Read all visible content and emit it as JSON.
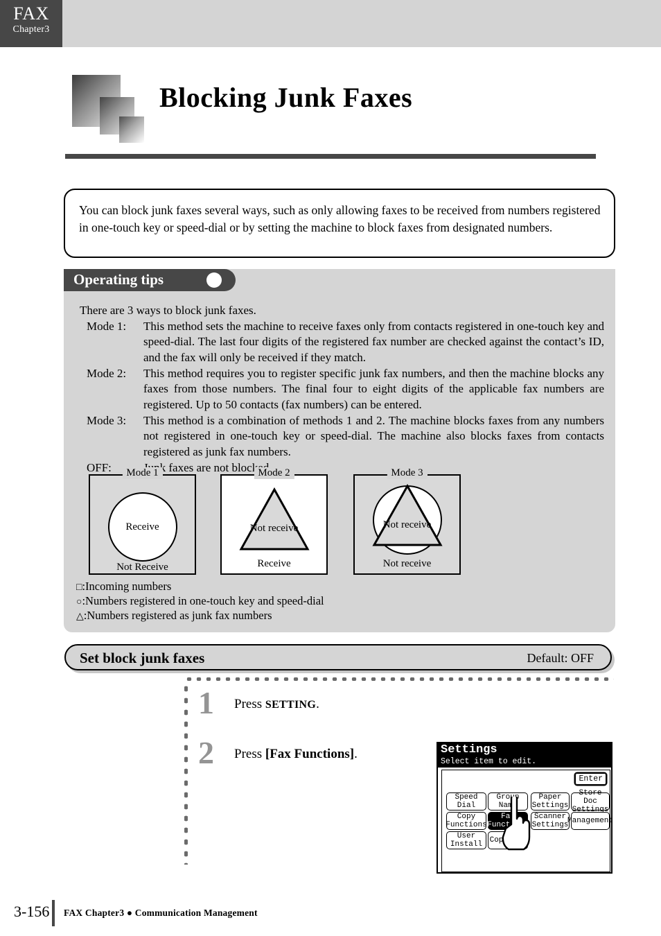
{
  "header": {
    "chapter_main": "FAX",
    "chapter_sub": "Chapter3"
  },
  "page_title": "Blocking Junk Faxes",
  "intro": "You can block junk faxes several ways, such as only allowing faxes to be received from numbers registered in one-touch key  or speed-dial or by setting the machine to block faxes from designated numbers.",
  "tips": {
    "header_label": "Operating tips",
    "header_icon": "circle-icon",
    "intro": "There are 3 ways to block junk faxes.",
    "modes": [
      {
        "label": "Mode 1:",
        "body": "This method sets the machine to receive faxes only from contacts registered in one-touch key and speed-dial. The last four digits of the registered fax number are checked against the contact’s ID, and the fax will only be received if they match."
      },
      {
        "label": "Mode 2:",
        "body": "This method requires you to register specific junk fax numbers, and then the machine blocks any faxes from those numbers. The final four to eight digits of the applicable fax numbers are registered. Up to 50 contacts (fax numbers) can be entered."
      },
      {
        "label": "Mode 3:",
        "body": "This method is a combination of methods 1 and 2. The machine blocks faxes from any numbers not registered in one-touch key or speed-dial. The machine also blocks faxes from contacts registered as junk fax numbers."
      },
      {
        "label": "OFF:",
        "body": "Junk faxes are not blocked."
      }
    ],
    "diagrams": [
      {
        "title": "Mode 1",
        "box_fill": "grey",
        "inner_text": "Receive",
        "outer_text": "Not Receive",
        "shapes": "circle"
      },
      {
        "title": "Mode 2",
        "box_fill": "white",
        "inner_text": "Not\nreceive",
        "outer_text": "Receive",
        "shapes": "triangle"
      },
      {
        "title": "Mode 3",
        "box_fill": "grey",
        "inner_text": "Not\nreceive",
        "outer_text": "Not receive",
        "shapes": "circle-triangle"
      }
    ],
    "legend": [
      {
        "glyph": "□",
        "text": ":Incoming numbers"
      },
      {
        "glyph": "○",
        "text": ":Numbers registered in one-touch key and speed-dial"
      },
      {
        "glyph": "△",
        "text": ":Numbers registered as junk fax numbers"
      }
    ]
  },
  "setting_bar": {
    "title": "Set block junk faxes",
    "default": "Default: OFF"
  },
  "steps": [
    {
      "number": "1",
      "prefix": "Press ",
      "key": "SETTING",
      "suffix": ".",
      "key_style": "smallcaps"
    },
    {
      "number": "2",
      "prefix": "Press ",
      "key": "[Fax Functions]",
      "suffix": ".",
      "key_style": "bold"
    }
  ],
  "lcd": {
    "title": "Settings",
    "subtitle": "Select item to edit.",
    "enter_label": "Enter",
    "buttons": [
      {
        "label": "Speed Dial",
        "selected": false
      },
      {
        "label": "Group Name",
        "selected": false
      },
      {
        "label": "Paper\nSettings",
        "selected": false
      },
      {
        "label": "Store Doc\nSettings",
        "selected": false
      },
      {
        "label": "Copy\nFunctions",
        "selected": false
      },
      {
        "label": "Fax\nFunctions",
        "selected": true
      },
      {
        "label": "Scanner\nSettings",
        "selected": false
      },
      {
        "label": "Management",
        "selected": false
      },
      {
        "label": "User\nInstall",
        "selected": false
      },
      {
        "label": "Copy Fax",
        "selected": false
      }
    ],
    "pointer_icon": "hand-pointer-icon"
  },
  "footer": {
    "page_number": "3-156",
    "text": "FAX Chapter3 ● Communication Management"
  }
}
